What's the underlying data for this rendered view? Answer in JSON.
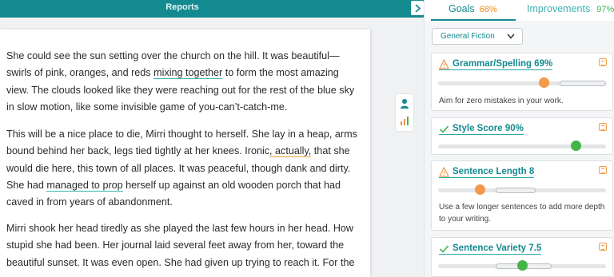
{
  "header": {
    "title": "Reports"
  },
  "editor": {
    "paragraphs": [
      {
        "segments": [
          {
            "text": "She could see the sun setting over the church on the hill. It was beautiful—swirls of pink, oranges, and reds ",
            "hl": ""
          },
          {
            "text": "mixing together",
            "hl": "blue"
          },
          {
            "text": " to form the most amazing view. The clouds looked like they were reaching out for the rest of the blue sky in slow motion, like some invisible game of you-can’t-catch-me.",
            "hl": ""
          }
        ]
      },
      {
        "segments": [
          {
            "text": "This will be a nice place to die, Mirri thought to herself. She lay in a heap, arms bound behind her back, legs tied tightly at her knees. Ironic",
            "hl": ""
          },
          {
            "text": ", actually,",
            "hl": "orange"
          },
          {
            "text": " that she would die here, this town of all places. It was peaceful, though dank and dirty. She had ",
            "hl": ""
          },
          {
            "text": "managed to prop",
            "hl": "blue"
          },
          {
            "text": " herself up against an old wooden porch that had caved in from years of abandonment.",
            "hl": ""
          }
        ]
      },
      {
        "segments": [
          {
            "text": "Mirri shook her head tiredly as she played the last few hours in her head. How stupid she had been. Her journal laid several feet away from her, toward the beautiful sunset. It was even open. She had given up trying to reach it. For the",
            "hl": ""
          }
        ]
      }
    ]
  },
  "tools": {
    "icons": [
      "person-icon",
      "bar-chart-icon"
    ]
  },
  "panel": {
    "tabs": {
      "goals": {
        "label": "Goals",
        "pct": "68%"
      },
      "improvements": {
        "label": "Improvements",
        "pct": "97%"
      }
    },
    "genre": {
      "selected": "General Fiction"
    },
    "cards": [
      {
        "title": "Grammar/Spelling 69%",
        "status": "warning",
        "level": 0.63,
        "note": "Aim for zero mistakes in your work."
      },
      {
        "title": "Style Score 90%",
        "status": "ok",
        "level": 0.82,
        "note": ""
      },
      {
        "title": "Sentence Length 8",
        "status": "warning",
        "level": 0.25,
        "note": "Use a few longer sentences to add more depth to your writing."
      },
      {
        "title": "Sentence Variety 7.5",
        "status": "ok",
        "level": 0.5,
        "note": ""
      }
    ],
    "colors": {
      "teal": "#138a8f",
      "orange": "#f2994a",
      "green": "#43b548"
    }
  }
}
